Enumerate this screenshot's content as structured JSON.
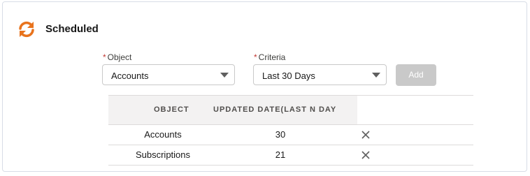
{
  "header": {
    "title": "Scheduled",
    "icon": "refresh-icon",
    "icon_color": "#e8731d"
  },
  "form": {
    "object": {
      "label": "Object",
      "required_mark": "*",
      "value": "Accounts"
    },
    "criteria": {
      "label": "Criteria",
      "required_mark": "*",
      "value": "Last 30 Days"
    },
    "add_label": "Add"
  },
  "table": {
    "columns": [
      "OBJECT",
      "UPDATED DATE(LAST N DAY"
    ],
    "rows": [
      {
        "object": "Accounts",
        "days": "30"
      },
      {
        "object": "Subscriptions",
        "days": "21"
      }
    ],
    "delete_icon": "close-icon"
  }
}
